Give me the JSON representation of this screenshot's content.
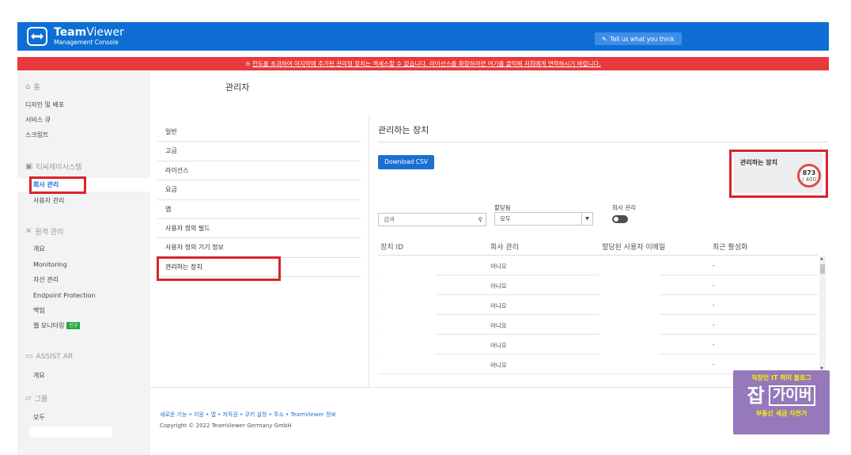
{
  "header": {
    "brand_bold": "Team",
    "brand_light": "Viewer",
    "subtitle": "Management Console",
    "feedback_label": "Tell us what you think"
  },
  "banner": {
    "text": "한도를 초과하여 마지막에 추가된 관리형 장치는 액세스할 수 없습니다. 라이선스를 확장하려면 여기를 클릭해 저희에게 연락하시기 바랍니다."
  },
  "sidebar": {
    "home": "홈",
    "items_main": [
      "디자인 및 배포",
      "서비스 큐",
      "스크립트"
    ],
    "company_section": "티씨제이시스템",
    "company_items": [
      "회사 관리",
      "사용자 관리"
    ],
    "remote_section": "원격 관리",
    "remote_items": [
      "개요",
      "Monitoring",
      "자산 관리",
      "Endpoint Protection",
      "백업",
      "웹 모니터링"
    ],
    "web_badge": "신규",
    "assist_section": "ASSIST AR",
    "assist_items": [
      "개요"
    ],
    "group_section": "그룹",
    "group_items": [
      "모두"
    ]
  },
  "page": {
    "title": "관리자"
  },
  "subnav": {
    "items": [
      "일반",
      "고급",
      "라이선스",
      "요금",
      "앱",
      "사용자 정의 필드",
      "사용자 정의 기기 정보",
      "관리하는 장치"
    ]
  },
  "content": {
    "title": "관리하는 장치",
    "download_label": "Download CSV",
    "stat": {
      "label": "관리하는 장치",
      "value": "873",
      "max": "/ 400"
    },
    "filters": {
      "search_placeholder": "검색",
      "assigned_label": "할당됨",
      "assigned_value": "모두",
      "company_label": "회사 관리"
    },
    "table": {
      "headers": [
        "장치 ID",
        "회사 관리",
        "할당된 사용자 이메일",
        "최근 활성화"
      ],
      "rows": [
        [
          "",
          "아니오",
          "",
          "-"
        ],
        [
          "",
          "아니오",
          "",
          "-"
        ],
        [
          "",
          "아니오",
          "",
          "-"
        ],
        [
          "",
          "아니오",
          "",
          "-"
        ],
        [
          "",
          "아니오",
          "",
          "-"
        ],
        [
          "",
          "아니오",
          "",
          "-"
        ]
      ]
    }
  },
  "footer": {
    "links": "새로운 기능 • 지원 • 앱 • 저작권 • 쿠키 설정 • 주소 • TeamViewer 정보",
    "copyright": "Copyright © 2022 TeamViewer Germany GmbH"
  },
  "watermark": {
    "top": "직장인 IT 취미 블로그",
    "big": "잡",
    "box": "가이버",
    "bottom": "부동산 세금 자전거"
  },
  "colors": {
    "header_bg": "#0e6ed3",
    "banner_bg": "#e8393c",
    "accent": "#1c6fd0",
    "highlight": "#d9232d"
  }
}
